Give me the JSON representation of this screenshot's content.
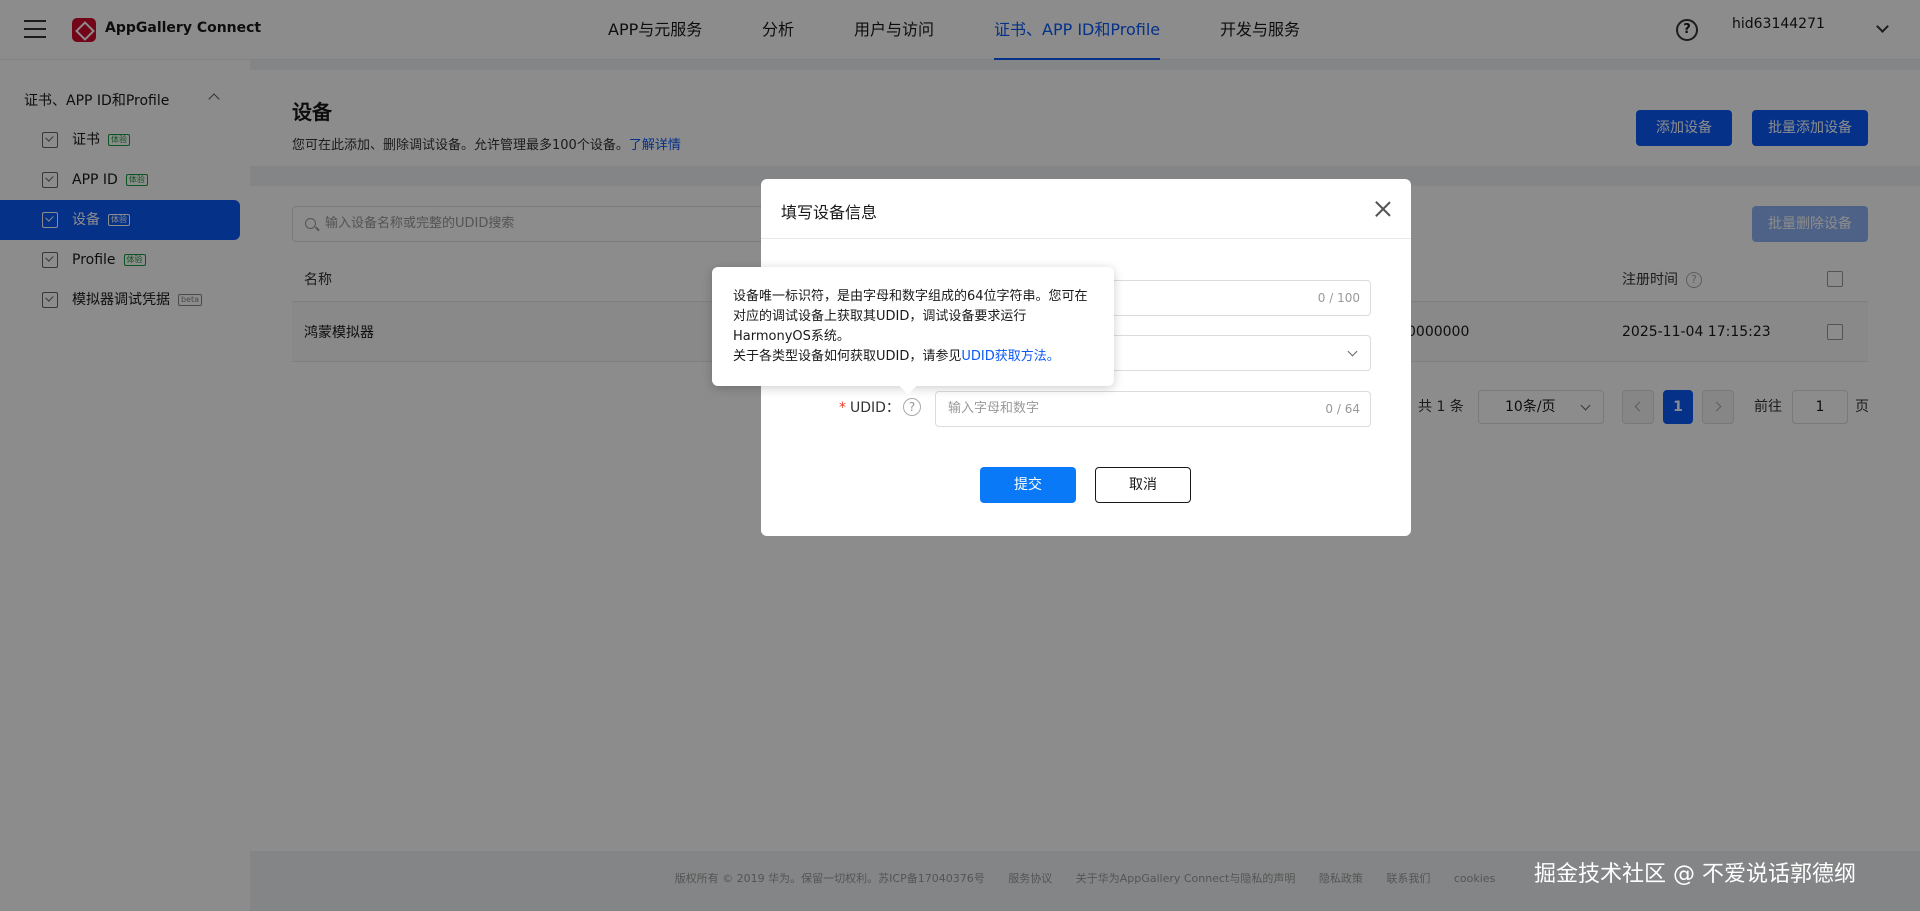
{
  "header": {
    "brand": "AppGallery Connect",
    "nav": [
      "APP与元服务",
      "分析",
      "用户与访问",
      "证书、APP ID和Profile",
      "开发与服务"
    ],
    "active_nav": "证书、APP ID和Profile",
    "help_glyph": "?",
    "user": "hid63144271"
  },
  "sidebar": {
    "group": "证书、APP ID和Profile",
    "items": [
      {
        "label": "证书",
        "tag": "体验"
      },
      {
        "label": "APP ID",
        "tag": "体验"
      },
      {
        "label": "设备",
        "tag": "体验"
      },
      {
        "label": "Profile",
        "tag": "体验"
      },
      {
        "label": "模拟器调试凭据",
        "tag": "beta"
      }
    ],
    "active": "设备"
  },
  "page": {
    "title": "设备",
    "desc": "您可在此添加、删除调试设备。允许管理最多100个设备。",
    "desc_link": "了解详情",
    "add_button": "添加设备",
    "batch_add_button": "批量添加设备",
    "search_placeholder": "输入设备名称或完整的UDID搜索",
    "batch_delete_button": "批量删除设备"
  },
  "table": {
    "columns": [
      "名称",
      "注册时间"
    ],
    "rows": [
      {
        "name": "鸿蒙模拟器",
        "udid_tail": "0000000",
        "time": "2025-11-04 17:15:23"
      }
    ]
  },
  "pagination": {
    "total": "共 1 条",
    "page_size": "10条/页",
    "current_page": "1",
    "goto_label": "前往",
    "goto_value": "1",
    "page_unit": "页"
  },
  "dialog": {
    "title": "填写设备信息",
    "name_count": "0 / 100",
    "udid_label": "UDID：",
    "udid_required": "*",
    "udid_placeholder": "输入字母和数字",
    "udid_count": "0 / 64",
    "submit": "提交",
    "cancel": "取消"
  },
  "tooltip": {
    "line1": "设备唯一标识符，是由字母和数字组成的64位字符串。您可在对应的调试设备上获取其UDID，调试设备要求运行HarmonyOS系统。",
    "line2": "关于各类型设备如何获取UDID，请参见",
    "link": "UDID获取方法。"
  },
  "footer": {
    "copyright": "版权所有 © 2019 华为。保留一切权利。苏ICP备17040376号",
    "links": [
      "服务协议",
      "关于华为AppGallery Connect与隐私的声明",
      "隐私政策",
      "联系我们",
      "cookies"
    ]
  },
  "watermark": "掘金技术社区 @ 不爱说话郭德纲",
  "colors": {
    "accent": "#0a59f7",
    "required": "#e84026"
  }
}
